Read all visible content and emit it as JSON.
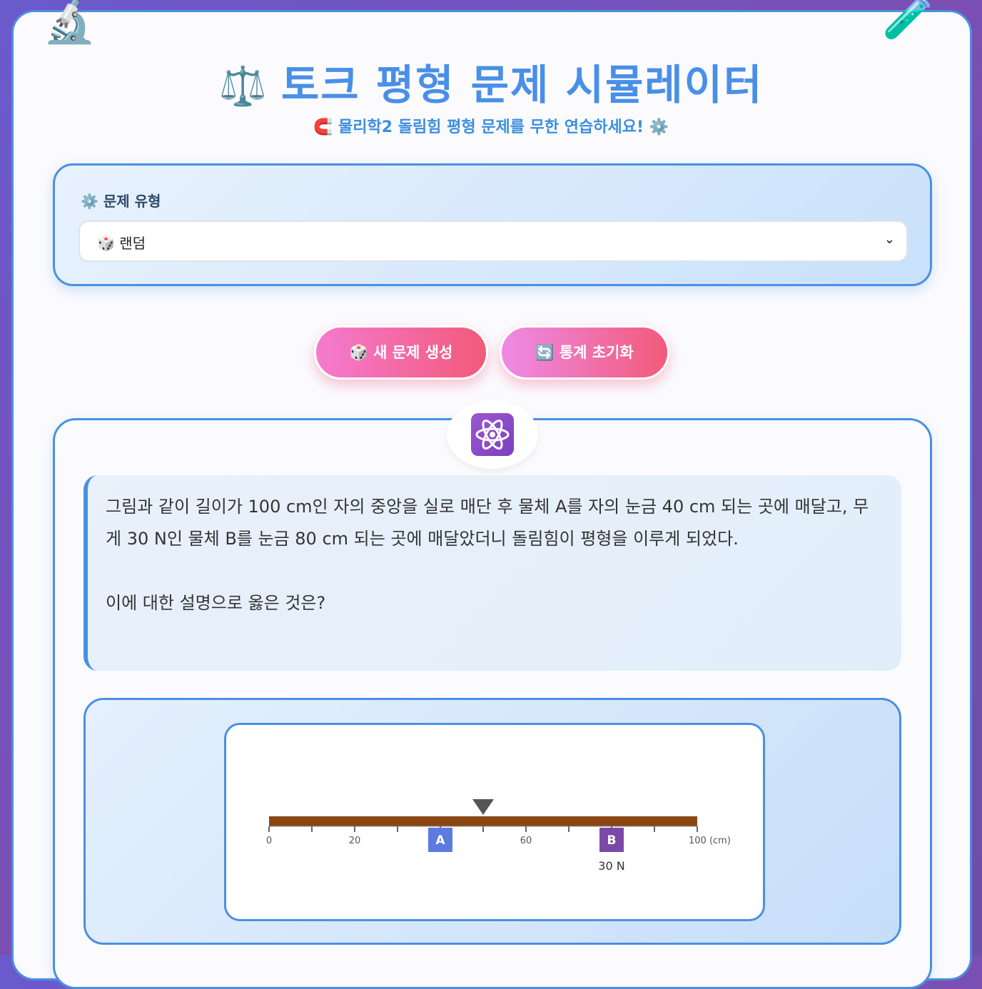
{
  "header": {
    "title": "토크 평형 문제 시뮬레이터",
    "title_icon": "⚖️",
    "subtitle": "물리학2 돌림힘 평형 문제를 무한 연습하세요!",
    "subtitle_icon_left": "🧲",
    "subtitle_icon_right": "⚙️",
    "deco_left_icon": "🔬",
    "deco_right_icon": "🧪"
  },
  "controls": {
    "type_label": "문제 유형",
    "type_icon": "⚙️",
    "select_value": "랜덤",
    "select_icon": "🎲"
  },
  "buttons": {
    "new_label": "새 문제 생성",
    "new_icon": "🎲",
    "reset_label": "통계 초기화",
    "reset_icon": "🔄"
  },
  "problem": {
    "icon": "⚛️",
    "text_1": "그림과 같이 길이가 100 cm인 자의 중앙을 실로 매단 후 물체 A를 자의 눈금 40 cm 되는 곳에 매달고, 무게 30 N인 물체 B를 눈금 80 cm 되는 곳에 매달았더니 돌림힘이 평형을 이루게 되었다.",
    "text_2": "이에 대한 설명으로 옳은 것은?"
  },
  "figure": {
    "tick_labels": [
      "0",
      "20",
      "60",
      "100 (cm)"
    ],
    "label_a": "A",
    "label_b": "B",
    "weight_b": "30 N",
    "colors": {
      "ruler": "#8b4513",
      "pivot": "#555555",
      "a_box": "#5b7be0",
      "b_box": "#7b4aa8"
    }
  }
}
